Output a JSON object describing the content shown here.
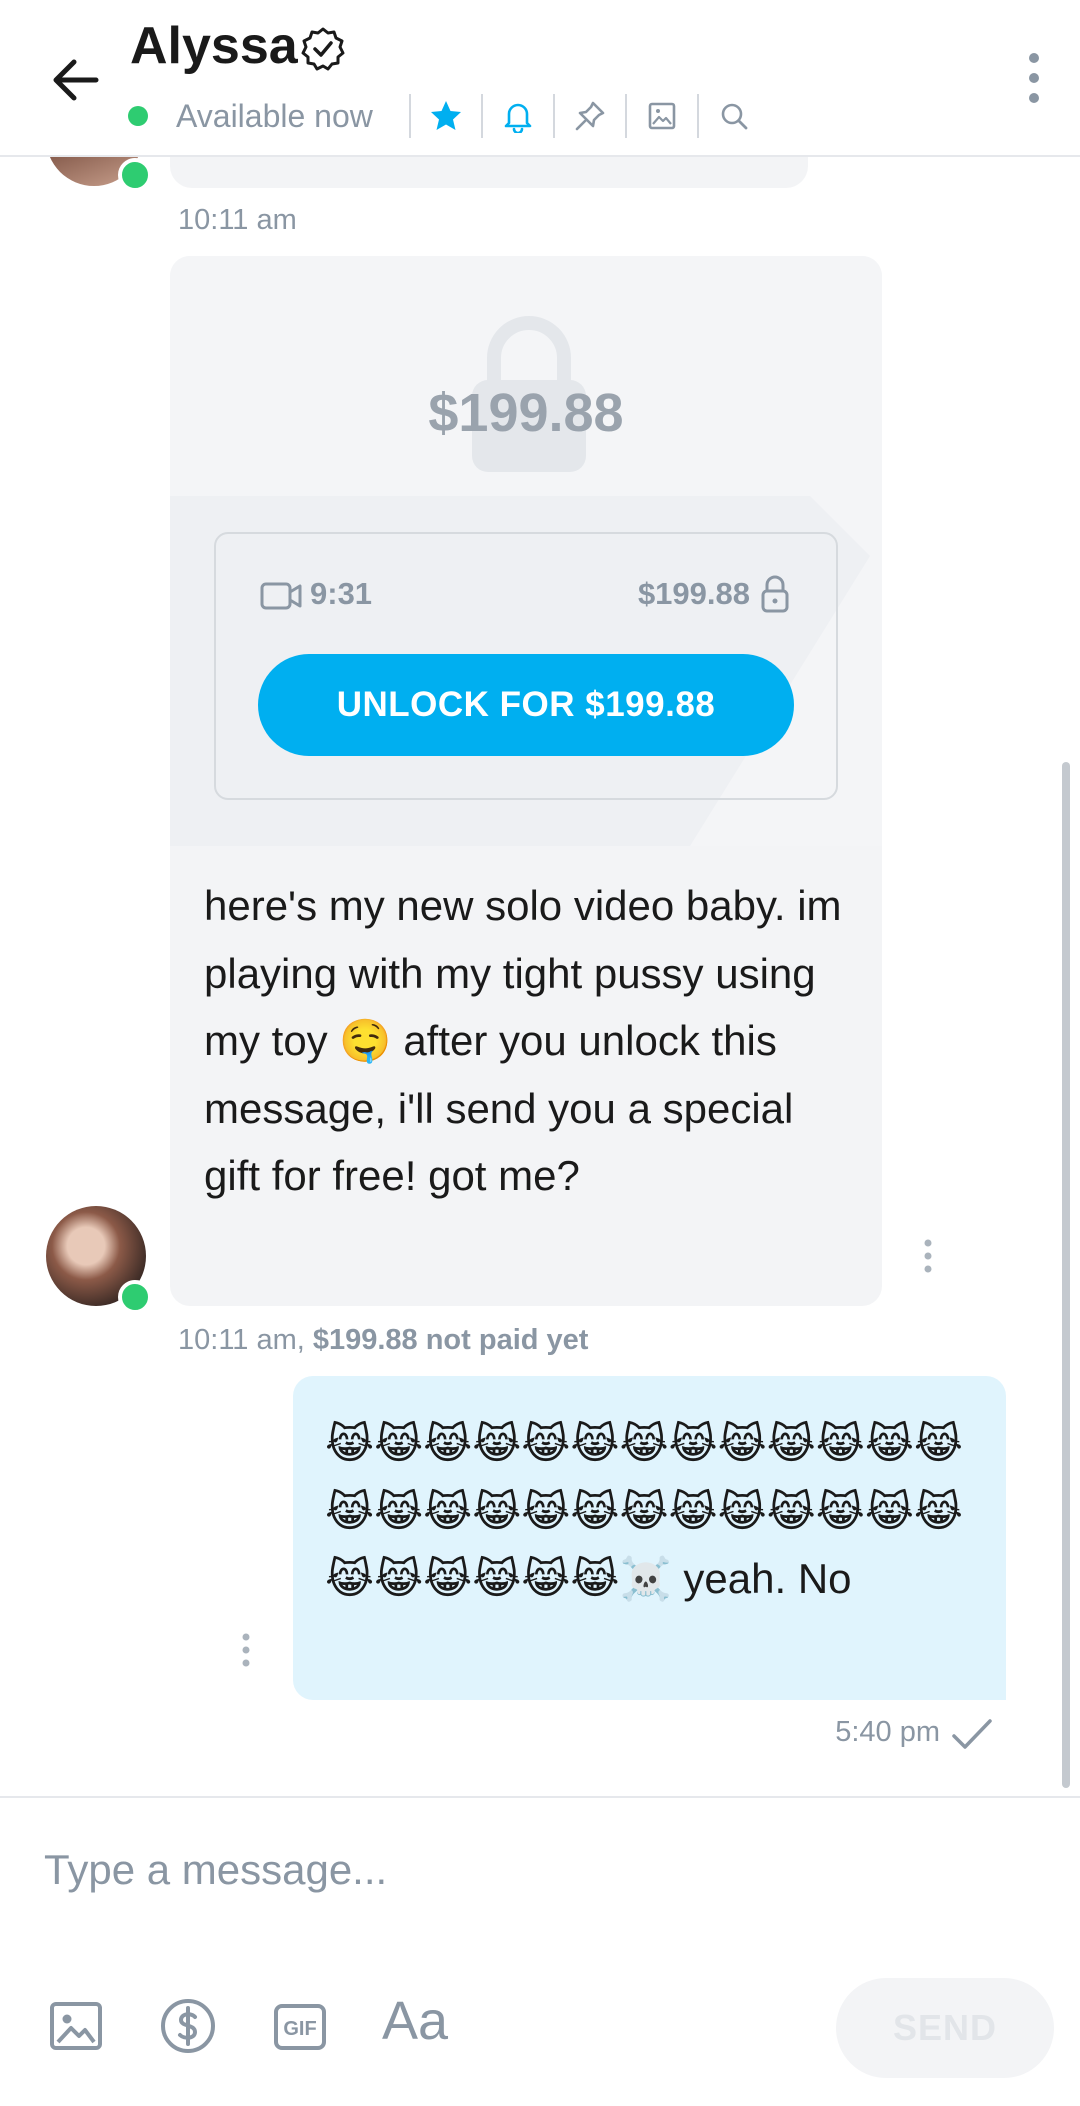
{
  "header": {
    "name": "Alyssa",
    "status": "Available now",
    "icons": [
      "back-arrow-icon",
      "verified-icon",
      "star-icon",
      "bell-icon",
      "pin-icon",
      "image-icon",
      "search-icon",
      "more-vert-icon"
    ],
    "accent_color": "#00aff0",
    "online_color": "#2ecc71"
  },
  "chat": {
    "first_time": "10:11 am",
    "locked_message": {
      "price_overlay": "$199.88",
      "duration": "9:31",
      "price": "$199.88",
      "unlock_label": "UNLOCK FOR $199.88",
      "text": "here's my new solo video baby. im playing with my tight pussy using my toy 🤤 after you unlock this message, i'll send you a special gift for free! got me?",
      "time": "10:11 am,",
      "paid_status": "$199.88 not paid yet"
    },
    "my_message": {
      "text": "😹😹😹😹😹😹😹😹😹😹😹😹😹😹😹😹😹😹😹😹😹😹😹😹😹😹😹😹😹😹😹😹☠️ yeah. No",
      "time": "5:40 pm"
    }
  },
  "composer": {
    "placeholder": "Type a message...",
    "aa_label": "Aa",
    "gif_label": "GIF",
    "send_label": "SEND"
  }
}
